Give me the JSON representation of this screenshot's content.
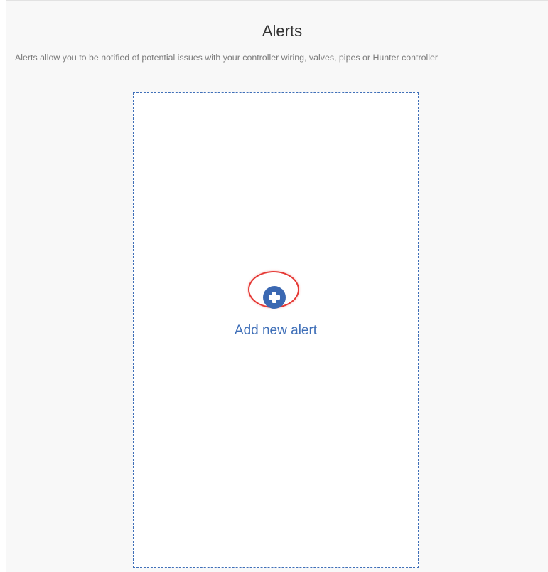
{
  "header": {
    "title": "Alerts",
    "description": "Alerts allow you to be notified of potential issues with your controller wiring, valves, pipes or Hunter controller"
  },
  "add_card": {
    "label": "Add new alert",
    "icon": "plus-circle-icon",
    "icon_color": "#3b68b2",
    "highlight_color": "#e53935",
    "border_color": "#3f6fb8"
  }
}
